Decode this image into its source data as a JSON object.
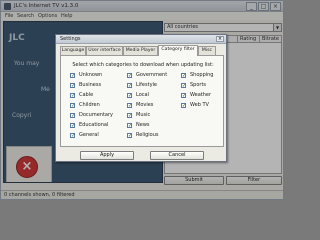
{
  "window": {
    "title": "JLC's Internet TV v1.3.0",
    "minimize_glyph": "_",
    "maximize_glyph": "□",
    "close_glyph": "×"
  },
  "menu": [
    "File",
    "Search",
    "Options",
    "Help"
  ],
  "left_panel": {
    "heading": "JLC",
    "lines": [
      "You may",
      "Me",
      "Copyri"
    ],
    "error_icon_glyph": "×"
  },
  "right_panel": {
    "country_select": "All countries",
    "columns": [
      "Rating",
      "Bitrate"
    ],
    "submit_label": "Submit",
    "filter_label": "Filter"
  },
  "status": "0 channels shown, 0 filtered",
  "dialog": {
    "title": "Settings",
    "close_glyph": "×",
    "tabs": [
      "Language",
      "User interface",
      "Media Player",
      "Category filter",
      "Misc"
    ],
    "active_tab": "Category filter",
    "instructions": "Select which categories to download when updating list:",
    "check_glyph": "✓",
    "categories": [
      [
        "Unknown",
        "Business",
        "Cable",
        "Children",
        "Documentary",
        "Educational",
        "General"
      ],
      [
        "Government",
        "Lifestyle",
        "Local",
        "Movies",
        "Music",
        "News",
        "Religious"
      ],
      [
        "Shopping",
        "Sports",
        "Weather",
        "Web TV"
      ]
    ],
    "apply_label": "Apply",
    "cancel_label": "Cancel"
  },
  "colors": {
    "left_panel_bg": "#2f4e6b",
    "error_red": "#d22b2b"
  }
}
